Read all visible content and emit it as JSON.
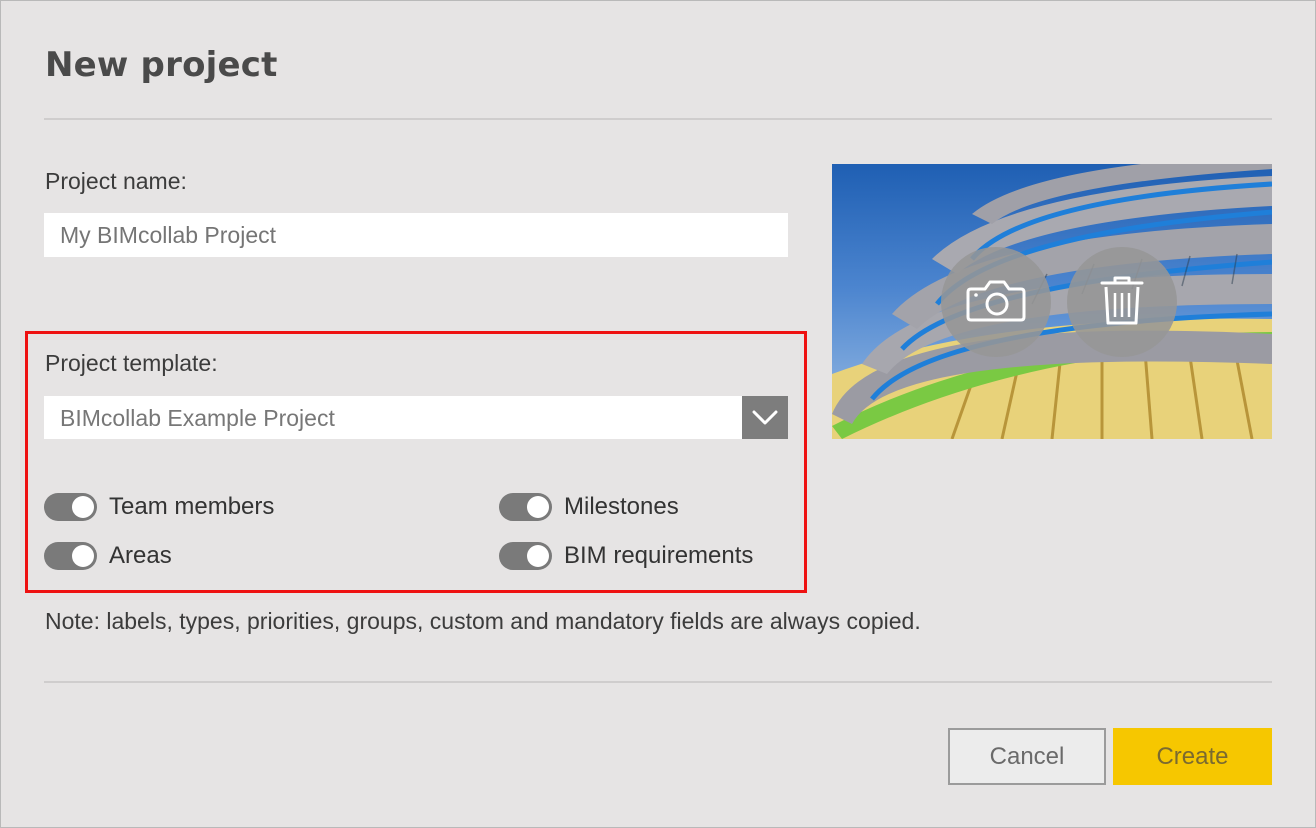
{
  "dialog": {
    "title": "New project",
    "project_name": {
      "label": "Project name:",
      "value": "",
      "placeholder": "My BIMcollab Project"
    },
    "project_template": {
      "label": "Project template:",
      "selected": "BIMcollab Example Project"
    },
    "toggles": [
      {
        "label": "Team members",
        "on": true
      },
      {
        "label": "Milestones",
        "on": true
      },
      {
        "label": "Areas",
        "on": true
      },
      {
        "label": "BIM requirements",
        "on": true
      }
    ],
    "note": "Note: labels, types, priorities, groups, custom and mandatory fields are always copied.",
    "image_actions": {
      "camera_icon": "camera-icon",
      "delete_icon": "trash-icon"
    },
    "buttons": {
      "cancel": "Cancel",
      "create": "Create"
    }
  },
  "colors": {
    "background": "#e6e4e4",
    "toggle_track": "#7a7a7a",
    "create_button": "#f6c700",
    "highlight_border": "#ee1111"
  }
}
